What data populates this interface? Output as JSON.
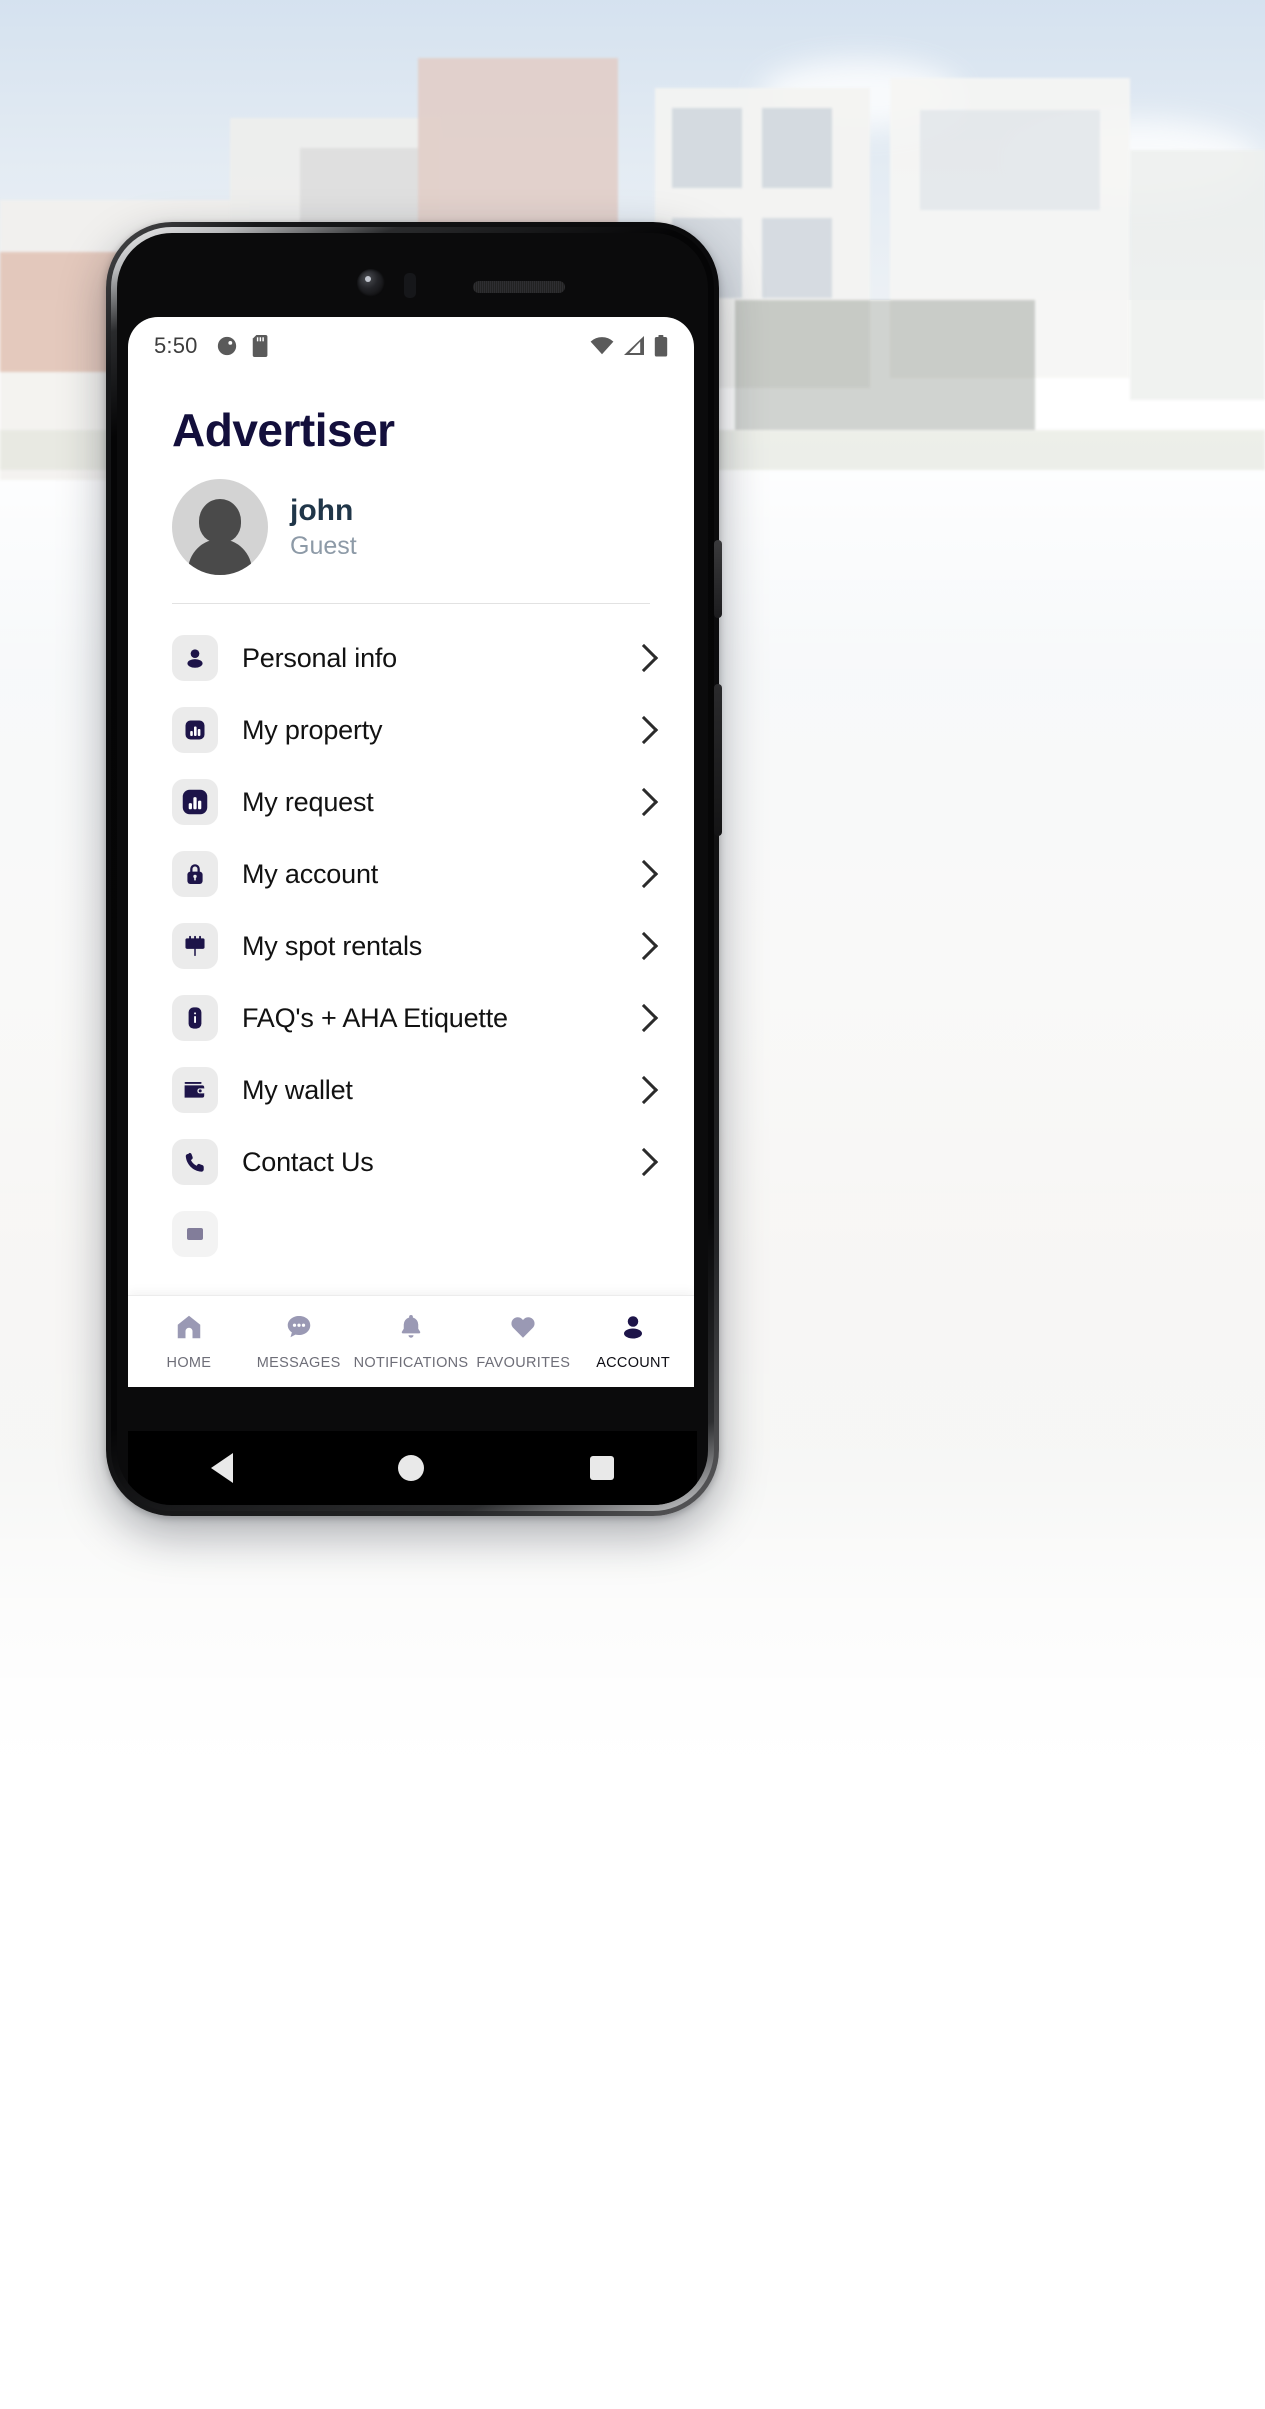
{
  "statusbar": {
    "time": "5:50",
    "left_icons": [
      "contrast-icon",
      "sd-card-icon"
    ],
    "right_icons": [
      "wifi-icon",
      "cell-signal-icon",
      "battery-icon"
    ]
  },
  "header": {
    "title": "Advertiser"
  },
  "profile": {
    "avatar": "default-user-avatar",
    "name": "john",
    "role": "Guest"
  },
  "menu": {
    "items": [
      {
        "label": "Personal info",
        "icon": "person-icon",
        "chevron": "chevron-right-icon"
      },
      {
        "label": "My property",
        "icon": "chart-bar-icon",
        "chevron": "chevron-right-icon"
      },
      {
        "label": "My request",
        "icon": "chart-bar-filled-icon",
        "chevron": "chevron-right-icon"
      },
      {
        "label": "My account",
        "icon": "lock-icon",
        "chevron": "chevron-right-icon"
      },
      {
        "label": "My spot rentals",
        "icon": "billboard-icon",
        "chevron": "chevron-right-icon"
      },
      {
        "label": "FAQ's + AHA Etiquette",
        "icon": "info-icon",
        "chevron": "chevron-right-icon"
      },
      {
        "label": "My wallet",
        "icon": "wallet-icon",
        "chevron": "chevron-right-icon"
      },
      {
        "label": "Contact Us",
        "icon": "phone-icon",
        "chevron": "chevron-right-icon"
      }
    ]
  },
  "bottom_nav": {
    "items": [
      {
        "label": "HOME",
        "icon": "home-icon",
        "active": false
      },
      {
        "label": "MESSAGES",
        "icon": "chat-bubble-icon",
        "active": false
      },
      {
        "label": "NOTIFICATIONS",
        "icon": "bell-icon",
        "active": false
      },
      {
        "label": "FAVOURITES",
        "icon": "heart-icon",
        "active": false
      },
      {
        "label": "ACCOUNT",
        "icon": "person-icon",
        "active": true
      }
    ]
  },
  "android_nav": {
    "buttons": [
      "back-button",
      "home-button",
      "recents-button"
    ]
  },
  "colors": {
    "brand_navy": "#1d1449",
    "title_navy": "#130f3c",
    "icon_tile_bg": "#ebebeb",
    "nav_inactive": "#9a99b4",
    "nav_active": "#1d1449",
    "profile_name": "#203649",
    "profile_role": "#8d9aa7"
  }
}
